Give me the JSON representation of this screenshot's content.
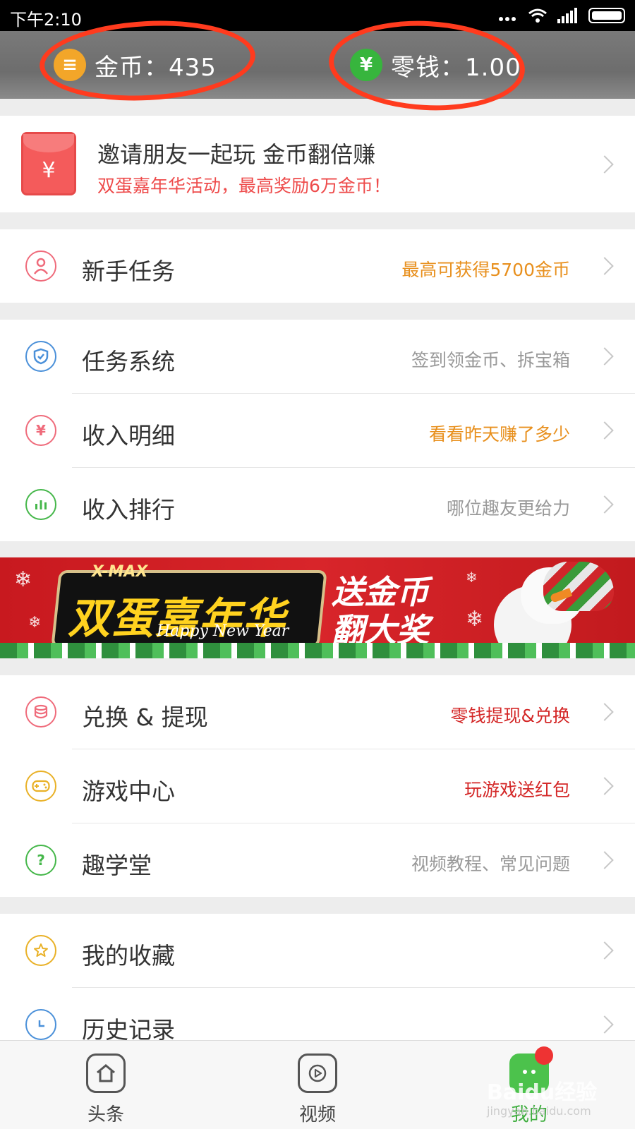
{
  "status_bar": {
    "time": "下午2:10"
  },
  "wallet": {
    "coins_label": "金币：435",
    "change_label": "零钱：1.00",
    "coin_symbol": "≡",
    "yen_symbol": "¥"
  },
  "invite": {
    "title": "邀请朋友一起玩 金币翻倍赚",
    "subtitle": "双蛋嘉年华活动，最高奖励6万金币！",
    "yen": "¥"
  },
  "newbie": {
    "label": "新手任务",
    "hint": "最高可获得5700金币"
  },
  "group1": [
    {
      "label": "任务系统",
      "hint": "签到领金币、拆宝箱"
    },
    {
      "label": "收入明细",
      "hint": "看看昨天赚了多少"
    },
    {
      "label": "收入排行",
      "hint": "哪位趣友更给力"
    }
  ],
  "banner": {
    "xmax": "X-MAX",
    "title": "双蛋嘉年华",
    "happy": "Happy New Year",
    "right_line1": "送金币",
    "right_line2": "翻大奖"
  },
  "group2": [
    {
      "label": "兑换 & 提现",
      "hint": "零钱提现&兑换"
    },
    {
      "label": "游戏中心",
      "hint": "玩游戏送红包"
    },
    {
      "label": "趣学堂",
      "hint": "视频教程、常见问题"
    }
  ],
  "group3": [
    {
      "label": "我的收藏",
      "hint": ""
    },
    {
      "label": "历史记录",
      "hint": ""
    }
  ],
  "bottom_nav": {
    "tabs": [
      {
        "label": "头条",
        "icon": "home-icon"
      },
      {
        "label": "视频",
        "icon": "play-icon"
      },
      {
        "label": "我的",
        "icon": "me-icon"
      }
    ]
  },
  "watermark": {
    "text": "Baidu经验",
    "url": "jingyan.baidu.com"
  },
  "colors": {
    "accent_orange": "#e8901e",
    "accent_red": "#d42828",
    "highlight_circle": "#ff3b1e",
    "tab_active": "#3fae3f"
  }
}
